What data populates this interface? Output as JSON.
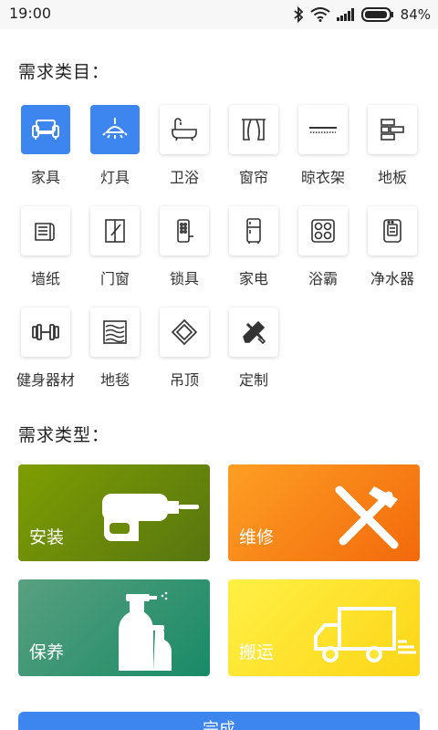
{
  "status_bar": {
    "time": "19:00",
    "battery": "84%"
  },
  "category_section": {
    "title": "需求类目：",
    "items": [
      {
        "label": "家具",
        "icon": "sofa-icon",
        "selected": true
      },
      {
        "label": "灯具",
        "icon": "ceiling-lamp-icon",
        "selected": true
      },
      {
        "label": "卫浴",
        "icon": "bathtub-icon",
        "selected": false
      },
      {
        "label": "窗帘",
        "icon": "curtain-icon",
        "selected": false
      },
      {
        "label": "晾衣架",
        "icon": "drying-rack-icon",
        "selected": false
      },
      {
        "label": "地板",
        "icon": "floor-board-icon",
        "selected": false
      },
      {
        "label": "墙纸",
        "icon": "wallpaper-roll-icon",
        "selected": false
      },
      {
        "label": "门窗",
        "icon": "door-window-icon",
        "selected": false
      },
      {
        "label": "锁具",
        "icon": "smart-lock-icon",
        "selected": false
      },
      {
        "label": "家电",
        "icon": "refrigerator-icon",
        "selected": false
      },
      {
        "label": "浴霸",
        "icon": "bath-heater-icon",
        "selected": false
      },
      {
        "label": "净水器",
        "icon": "water-purifier-icon",
        "selected": false
      },
      {
        "label": "健身器材",
        "icon": "dumbbell-icon",
        "selected": false
      },
      {
        "label": "地毯",
        "icon": "carpet-icon",
        "selected": false
      },
      {
        "label": "吊顶",
        "icon": "ceiling-panel-icon",
        "selected": false
      },
      {
        "label": "定制",
        "icon": "design-tools-icon",
        "selected": false
      }
    ]
  },
  "type_section": {
    "title": "需求类型：",
    "cards": [
      {
        "label": "安装",
        "icon": "drill-icon",
        "color_from": "#7a9a00",
        "color_to": "#5a7a10"
      },
      {
        "label": "维修",
        "icon": "hammer-screwdriver-icon",
        "color_from": "#fd9a22",
        "color_to": "#f36b0c"
      },
      {
        "label": "保养",
        "icon": "spray-bottles-icon",
        "color_from": "#4a9a7a",
        "color_to": "#1e8a68"
      },
      {
        "label": "搬运",
        "icon": "truck-icon",
        "color_from": "#ffea3a",
        "color_to": "#fcd81a"
      }
    ]
  },
  "submit": {
    "label": "完成"
  }
}
